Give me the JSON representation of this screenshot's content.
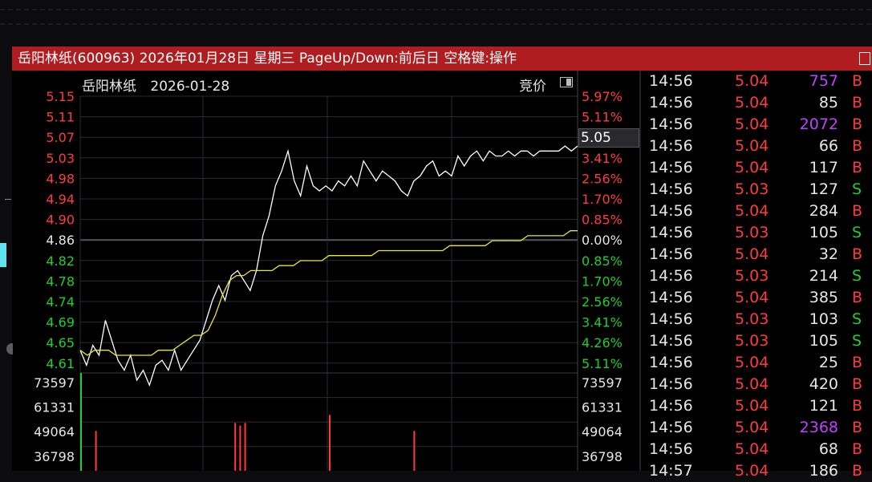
{
  "titlebar": {
    "text": "岳阳林纸(600963) 2026年01月28日 星期三 PageUp/Down:前后日 空格键:操作"
  },
  "header": {
    "stock_name": "岳阳林纸",
    "date": "2026-01-28",
    "mode_label": "竞价"
  },
  "current_price_label": "5.05",
  "colors": {
    "up": "#ff3b3b",
    "down": "#1fcf2a",
    "neutral": "#e6e6e6",
    "avg_line": "#e8e82c",
    "price_line": "#ffffff",
    "big_volume": "#c040ff",
    "title_bar": "#b01d20"
  },
  "price_axis": {
    "left_labels": [
      "5.15",
      "5.11",
      "5.07",
      "5.03",
      "4.98",
      "4.94",
      "4.90",
      "4.86",
      "4.82",
      "4.78",
      "4.74",
      "4.69",
      "4.65",
      "4.61"
    ],
    "right_labels": [
      "5.97%",
      "5.11%",
      "4.26%",
      "3.41%",
      "2.56%",
      "1.70%",
      "0.85%",
      "0.00%",
      "0.85%",
      "1.70%",
      "2.56%",
      "3.41%",
      "4.26%",
      "5.11%"
    ],
    "label_colors": [
      "up",
      "up",
      "up",
      "up",
      "up",
      "up",
      "up",
      "neutral",
      "down",
      "down",
      "down",
      "down",
      "down",
      "down"
    ]
  },
  "volume_axis": {
    "labels": [
      "73597",
      "61331",
      "49064",
      "36798"
    ]
  },
  "chart_data": {
    "type": "line",
    "title": "",
    "prev_close": 4.86,
    "ylim": [
      4.59,
      5.15
    ],
    "series": [
      {
        "color": "price_line",
        "values": [
          4.64,
          4.61,
          4.65,
          4.63,
          4.7,
          4.66,
          4.62,
          4.6,
          4.63,
          4.58,
          4.6,
          4.57,
          4.61,
          4.62,
          4.6,
          4.64,
          4.6,
          4.62,
          4.64,
          4.66,
          4.7,
          4.74,
          4.77,
          4.74,
          4.79,
          4.8,
          4.78,
          4.76,
          4.8,
          4.87,
          4.91,
          4.97,
          5.0,
          5.04,
          4.98,
          4.95,
          5.01,
          4.97,
          4.96,
          4.97,
          4.96,
          4.98,
          4.97,
          4.99,
          4.97,
          5.02,
          5.0,
          4.98,
          5.0,
          4.99,
          4.98,
          4.96,
          4.95,
          4.98,
          4.99,
          5.01,
          5.02,
          4.99,
          5.0,
          4.99,
          5.03,
          5.01,
          5.03,
          5.04,
          5.02,
          5.04,
          5.03,
          5.03,
          5.04,
          5.03,
          5.04,
          5.04,
          5.03,
          5.04,
          5.04,
          5.04,
          5.04,
          5.05,
          5.04,
          5.05
        ]
      },
      {
        "color": "avg_line",
        "values": [
          4.64,
          4.63,
          4.64,
          4.64,
          4.64,
          4.63,
          4.63,
          4.63,
          4.63,
          4.63,
          4.63,
          4.64,
          4.64,
          4.64,
          4.65,
          4.66,
          4.67,
          4.67,
          4.68,
          4.71,
          4.75,
          4.78,
          4.79,
          4.79,
          4.8,
          4.8,
          4.8,
          4.8,
          4.81,
          4.81,
          4.81,
          4.82,
          4.82,
          4.82,
          4.82,
          4.83,
          4.83,
          4.83,
          4.83,
          4.83,
          4.83,
          4.83,
          4.84,
          4.84,
          4.84,
          4.84,
          4.84,
          4.84,
          4.84,
          4.84,
          4.84,
          4.84,
          4.85,
          4.85,
          4.85,
          4.85,
          4.85,
          4.85,
          4.86,
          4.86,
          4.86,
          4.86,
          4.86,
          4.87,
          4.87,
          4.87,
          4.87,
          4.87,
          4.87,
          4.88,
          4.88
        ]
      }
    ],
    "volume_bars": [
      {
        "position": 0.0,
        "value": 73597,
        "color": "down"
      },
      {
        "position": 0.03,
        "value": 30000,
        "color": "up"
      },
      {
        "position": 0.31,
        "value": 36000,
        "color": "up"
      },
      {
        "position": 0.32,
        "value": 34000,
        "color": "up"
      },
      {
        "position": 0.33,
        "value": 36000,
        "color": "up"
      },
      {
        "position": 0.5,
        "value": 42000,
        "color": "up"
      },
      {
        "position": 0.67,
        "value": 30000,
        "color": "up"
      }
    ]
  },
  "tick_list": [
    {
      "time": "14:56",
      "price": "5.04",
      "price_color": "up",
      "volume": "757",
      "volume_color": "big_volume",
      "dir": "B",
      "dir_color": "up"
    },
    {
      "time": "14:56",
      "price": "5.04",
      "price_color": "up",
      "volume": "85",
      "volume_color": "neutral",
      "dir": "B",
      "dir_color": "up"
    },
    {
      "time": "14:56",
      "price": "5.04",
      "price_color": "up",
      "volume": "2072",
      "volume_color": "big_volume",
      "dir": "B",
      "dir_color": "up"
    },
    {
      "time": "14:56",
      "price": "5.04",
      "price_color": "up",
      "volume": "66",
      "volume_color": "neutral",
      "dir": "B",
      "dir_color": "up"
    },
    {
      "time": "14:56",
      "price": "5.04",
      "price_color": "up",
      "volume": "117",
      "volume_color": "neutral",
      "dir": "B",
      "dir_color": "up"
    },
    {
      "time": "14:56",
      "price": "5.03",
      "price_color": "up",
      "volume": "127",
      "volume_color": "neutral",
      "dir": "S",
      "dir_color": "down"
    },
    {
      "time": "14:56",
      "price": "5.04",
      "price_color": "up",
      "volume": "284",
      "volume_color": "neutral",
      "dir": "B",
      "dir_color": "up"
    },
    {
      "time": "14:56",
      "price": "5.03",
      "price_color": "up",
      "volume": "105",
      "volume_color": "neutral",
      "dir": "S",
      "dir_color": "down"
    },
    {
      "time": "14:56",
      "price": "5.04",
      "price_color": "up",
      "volume": "32",
      "volume_color": "neutral",
      "dir": "B",
      "dir_color": "up"
    },
    {
      "time": "14:56",
      "price": "5.03",
      "price_color": "up",
      "volume": "214",
      "volume_color": "neutral",
      "dir": "S",
      "dir_color": "down"
    },
    {
      "time": "14:56",
      "price": "5.04",
      "price_color": "up",
      "volume": "385",
      "volume_color": "neutral",
      "dir": "B",
      "dir_color": "up"
    },
    {
      "time": "14:56",
      "price": "5.03",
      "price_color": "up",
      "volume": "103",
      "volume_color": "neutral",
      "dir": "S",
      "dir_color": "down"
    },
    {
      "time": "14:56",
      "price": "5.03",
      "price_color": "up",
      "volume": "105",
      "volume_color": "neutral",
      "dir": "S",
      "dir_color": "down"
    },
    {
      "time": "14:56",
      "price": "5.04",
      "price_color": "up",
      "volume": "25",
      "volume_color": "neutral",
      "dir": "B",
      "dir_color": "up"
    },
    {
      "time": "14:56",
      "price": "5.04",
      "price_color": "up",
      "volume": "420",
      "volume_color": "neutral",
      "dir": "B",
      "dir_color": "up"
    },
    {
      "time": "14:56",
      "price": "5.04",
      "price_color": "up",
      "volume": "121",
      "volume_color": "neutral",
      "dir": "B",
      "dir_color": "up"
    },
    {
      "time": "14:56",
      "price": "5.04",
      "price_color": "up",
      "volume": "2368",
      "volume_color": "big_volume",
      "dir": "B",
      "dir_color": "up"
    },
    {
      "time": "14:56",
      "price": "5.04",
      "price_color": "up",
      "volume": "68",
      "volume_color": "neutral",
      "dir": "B",
      "dir_color": "up"
    },
    {
      "time": "14:57",
      "price": "5.04",
      "price_color": "up",
      "volume": "186",
      "volume_color": "neutral",
      "dir": "B",
      "dir_color": "up"
    }
  ]
}
